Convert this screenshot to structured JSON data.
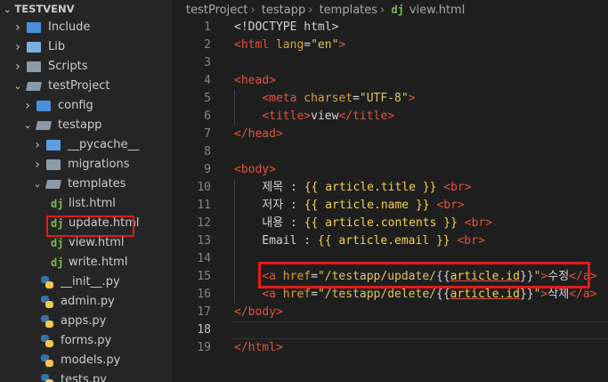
{
  "explorer": {
    "root": "TESTVENV",
    "items": [
      {
        "label": "Include",
        "type": "folder",
        "icon": "folder-blue-icon"
      },
      {
        "label": "Lib",
        "type": "folder",
        "icon": "folder-library-icon"
      },
      {
        "label": "Scripts",
        "type": "folder",
        "icon": "folder-scripts-icon"
      },
      {
        "label": "testProject",
        "type": "folder-open",
        "icon": "folder-open-icon"
      },
      {
        "label": "config",
        "type": "folder",
        "icon": "folder-config-icon"
      },
      {
        "label": "testapp",
        "type": "folder-open",
        "icon": "folder-open-icon"
      },
      {
        "label": "__pycache__",
        "type": "folder",
        "icon": "folder-pycache-icon"
      },
      {
        "label": "migrations",
        "type": "folder",
        "icon": "folder-icon"
      },
      {
        "label": "templates",
        "type": "folder-open",
        "icon": "folder-open-icon"
      },
      {
        "label": "list.html",
        "type": "file",
        "icon": "django-icon"
      },
      {
        "label": "update.html",
        "type": "file",
        "icon": "django-icon"
      },
      {
        "label": "view.html",
        "type": "file",
        "icon": "django-icon"
      },
      {
        "label": "write.html",
        "type": "file",
        "icon": "django-icon"
      },
      {
        "label": "__init__.py",
        "type": "file",
        "icon": "python-icon"
      },
      {
        "label": "admin.py",
        "type": "file",
        "icon": "python-icon"
      },
      {
        "label": "apps.py",
        "type": "file",
        "icon": "python-icon"
      },
      {
        "label": "forms.py",
        "type": "file",
        "icon": "python-icon"
      },
      {
        "label": "models.py",
        "type": "file",
        "icon": "python-icon"
      },
      {
        "label": "tests.py",
        "type": "file",
        "icon": "python-icon"
      }
    ]
  },
  "breadcrumb": {
    "parts": [
      "testProject",
      "testapp",
      "templates"
    ],
    "file_icon": "dj",
    "file": "view.html"
  },
  "editor": {
    "active_line": 18,
    "lines": [
      {
        "n": "1",
        "text": "<!DOCTYPE html>"
      },
      {
        "n": "2",
        "text": "<html lang=\"en\">"
      },
      {
        "n": "3",
        "text": ""
      },
      {
        "n": "4",
        "text": "<head>"
      },
      {
        "n": "5",
        "text": "    <meta charset=\"UTF-8\">"
      },
      {
        "n": "6",
        "text": "    <title>view</title>"
      },
      {
        "n": "7",
        "text": "</head>"
      },
      {
        "n": "8",
        "text": ""
      },
      {
        "n": "9",
        "text": "<body>"
      },
      {
        "n": "10",
        "text": "    제목 : {{ article.title }} <br>"
      },
      {
        "n": "11",
        "text": "    저자 : {{ article.name }} <br>"
      },
      {
        "n": "12",
        "text": "    내용 : {{ article.contents }} <br>"
      },
      {
        "n": "13",
        "text": "    Email : {{ article.email }} <br>"
      },
      {
        "n": "14",
        "text": ""
      },
      {
        "n": "15",
        "text": "    <a href=\"/testapp/update/{{article.id}}\">수정</a>"
      },
      {
        "n": "16",
        "text": "    <a href=\"/testapp/delete/{{article.id}}\">삭제</a>"
      },
      {
        "n": "17",
        "text": "</body>"
      },
      {
        "n": "18",
        "text": ""
      },
      {
        "n": "19",
        "text": "</html>"
      }
    ]
  },
  "colors": {
    "highlight": "#e21b1b",
    "tag": "#e2543c",
    "template": "#f3d24f",
    "string": "#e0c36a",
    "django": "#7eb94e"
  }
}
